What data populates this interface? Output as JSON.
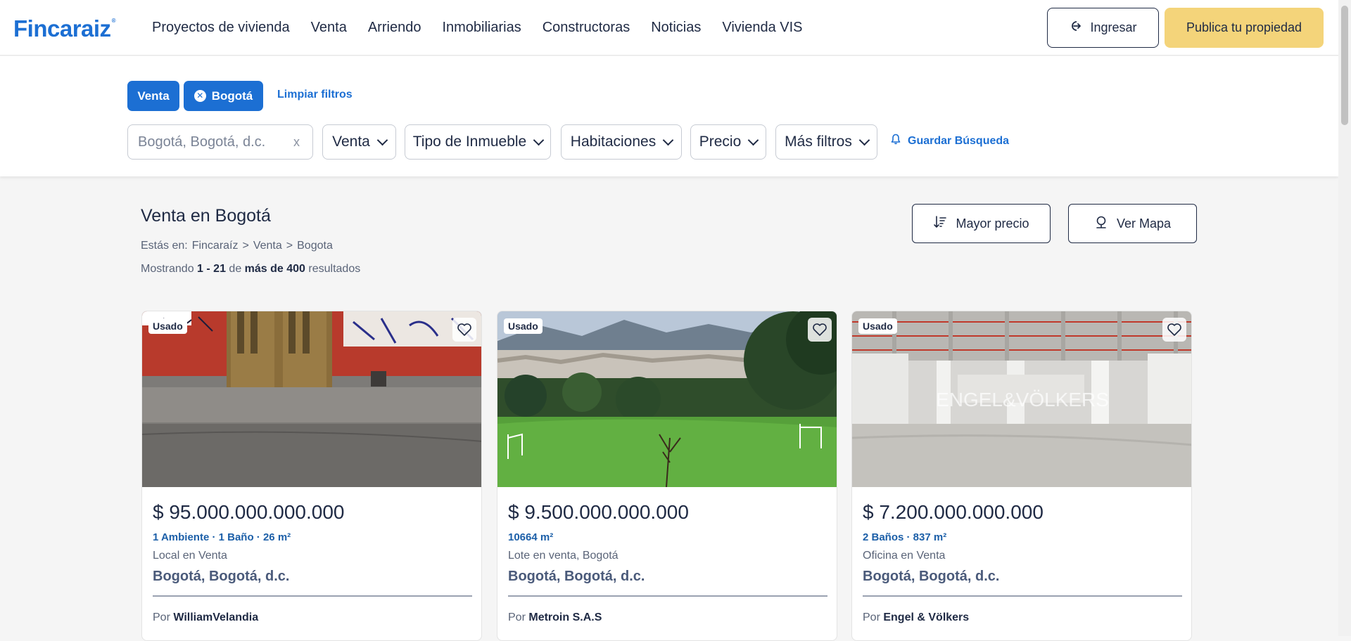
{
  "header": {
    "logo": "Fincaraiz",
    "nav": [
      "Proyectos de vivienda",
      "Venta",
      "Arriendo",
      "Inmobiliarias",
      "Constructoras",
      "Noticias",
      "Vivienda VIS"
    ],
    "login_label": "Ingresar",
    "publish_label": "Publica tu propiedad"
  },
  "filters": {
    "chips": [
      "Venta",
      "Bogotá"
    ],
    "clear_label": "Limpiar filtros",
    "search_placeholder": "Bogotá, Bogotá, d.c.",
    "search_clear": "x",
    "dropdowns": [
      "Venta",
      "Tipo de Inmueble",
      "Habitaciones",
      "Precio",
      "Más filtros"
    ],
    "save_search_label": "Guardar Búsqueda"
  },
  "results": {
    "title": "Venta en Bogotá",
    "breadcrumb_prefix": "Estás en:",
    "breadcrumb": [
      "Fincaraíz",
      ">",
      "Venta",
      ">",
      "Bogota"
    ],
    "count_prefix": "Mostrando",
    "count_range": "1 - 21",
    "count_mid": "de",
    "count_total": "más de 400",
    "count_suffix": "resultados",
    "sort_label": "Mayor precio",
    "map_label": "Ver Mapa"
  },
  "listings": [
    {
      "badge": "Usado",
      "price": "$ 95.000.000.000.000",
      "specs": "1 Ambiente  · 1 Baño · 26 m²",
      "type": "Local en Venta",
      "location": "Bogotá, Bogotá, d.c.",
      "agent_prefix": "Por",
      "agent": "WilliamVelandia"
    },
    {
      "badge": "Usado",
      "price": "$ 9.500.000.000.000",
      "specs": "10664 m²",
      "type": "Lote en venta, Bogotá",
      "location": "Bogotá, Bogotá, d.c.",
      "agent_prefix": "Por",
      "agent": "Metroin S.A.S"
    },
    {
      "badge": "Usado",
      "price": "$ 7.200.000.000.000",
      "specs": "2 Baños · 837 m²",
      "type": "Oficina en Venta",
      "location": "Bogotá, Bogotá, d.c.",
      "agent_prefix": "Por",
      "agent": "Engel & Völkers",
      "watermark": "ENGEL&VÖLKERS"
    }
  ],
  "colors": {
    "brand_blue": "#1c6fd3",
    "publish_yellow": "#f4d47a",
    "text_dark": "#1f2a44"
  }
}
